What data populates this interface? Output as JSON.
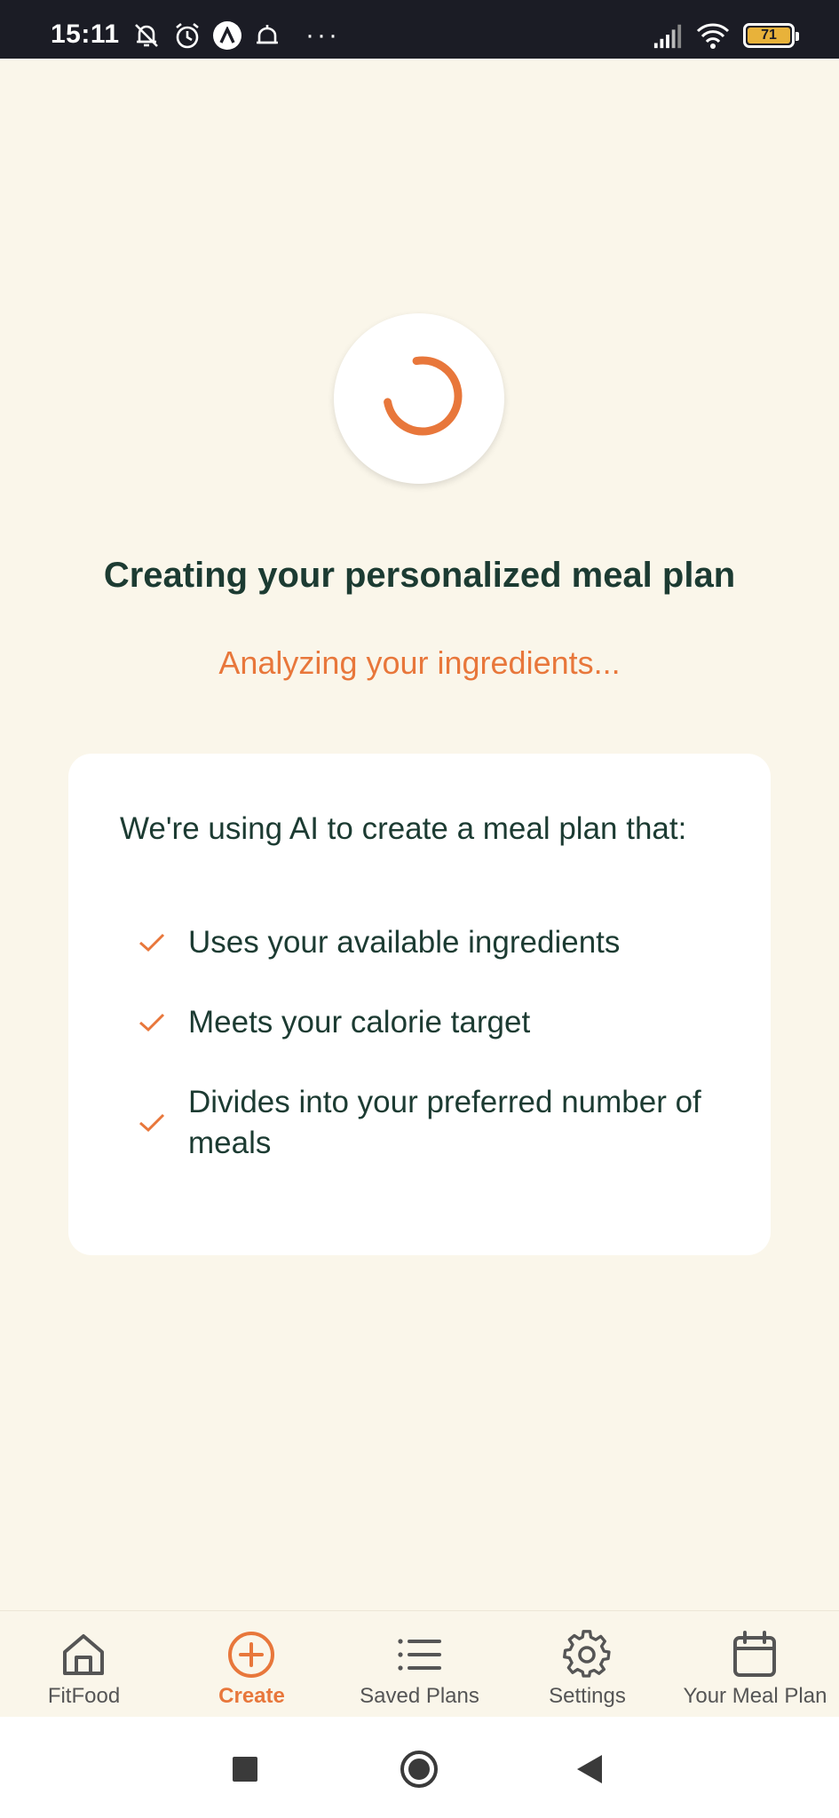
{
  "status_bar": {
    "time": "15:11",
    "battery_level": "71",
    "left_icons": [
      "muted-bell-icon",
      "alarm-icon",
      "a-app-icon",
      "notification-bell-icon",
      "more-dots-icon"
    ],
    "right_icons": [
      "signal-icon",
      "wifi-icon",
      "battery-icon"
    ],
    "dots": "···"
  },
  "loader": {
    "title": "Creating your personalized meal plan",
    "status_text": "Analyzing your ingredients..."
  },
  "info_card": {
    "intro": "We're using AI to create a meal plan that:",
    "features": [
      "Uses your available ingredients",
      "Meets your calorie target",
      "Divides into your preferred number of meals"
    ]
  },
  "tab_bar": {
    "tabs": [
      {
        "label": "FitFood",
        "icon": "home-icon",
        "active": false
      },
      {
        "label": "Create",
        "icon": "plus-circle-icon",
        "active": true
      },
      {
        "label": "Saved Plans",
        "icon": "list-icon",
        "active": false
      },
      {
        "label": "Settings",
        "icon": "gear-icon",
        "active": false
      },
      {
        "label": "Your Meal Plan",
        "icon": "calendar-icon",
        "active": false
      }
    ]
  },
  "colors": {
    "accent": "#e8773b",
    "text_dark": "#1c3b32",
    "background": "#faf6ea",
    "status_bar": "#1b1c25"
  }
}
